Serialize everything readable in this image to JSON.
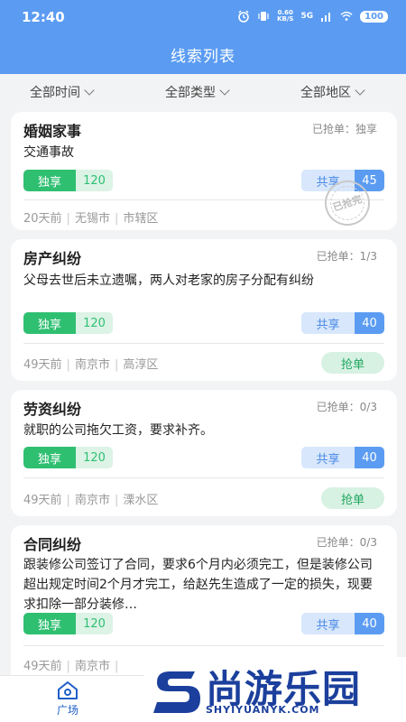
{
  "status": {
    "time": "12:40",
    "speed_value": "0.60",
    "speed_unit": "KB/S",
    "signal": "5G",
    "battery": "100"
  },
  "header": {
    "title": "线索列表"
  },
  "filters": [
    {
      "label": "全部时间"
    },
    {
      "label": "全部类型"
    },
    {
      "label": "全部地区"
    }
  ],
  "cards": [
    {
      "category": "婚姻家事",
      "grab_status": "已抢单：独享",
      "description": "交通事故",
      "exclusive_label": "独享",
      "exclusive_price": "120",
      "shared_label": "共享",
      "shared_price": "45",
      "days": "20天前",
      "city": "无锡市",
      "district": "市辖区",
      "stamp_text": "已抢完"
    },
    {
      "category": "房产纠纷",
      "grab_status": "已抢单：1/3",
      "description": "父母去世后未立遗嘱，两人对老家的房子分配有纠纷",
      "exclusive_label": "独享",
      "exclusive_price": "120",
      "shared_label": "共享",
      "shared_price": "40",
      "days": "49天前",
      "city": "南京市",
      "district": "高淳区",
      "action": "抢单"
    },
    {
      "category": "劳资纠纷",
      "grab_status": "已抢单：0/3",
      "description": "就职的公司拖欠工资，要求补齐。",
      "exclusive_label": "独享",
      "exclusive_price": "120",
      "shared_label": "共享",
      "shared_price": "40",
      "days": "49天前",
      "city": "南京市",
      "district": "溧水区",
      "action": "抢单"
    },
    {
      "category": "合同纠纷",
      "grab_status": "已抢单：0/3",
      "description": "跟装修公司签订了合同，要求6个月内必须完工，但是装修公司超出规定时间2个月才完工，给赵先生造成了一定的损失，现要求扣除一部分装修…",
      "exclusive_label": "独享",
      "exclusive_price": "120",
      "shared_label": "共享",
      "shared_price": "40",
      "days": "49天前",
      "city": "南京市"
    }
  ],
  "bottom_nav": {
    "home_label": "广场"
  },
  "watermark": {
    "brand": "尚游乐园",
    "url": "SHYIYUANYK.COM"
  },
  "colors": {
    "primary": "#5b9cf2",
    "green": "#2fbf71",
    "navy": "#1b3f9c"
  }
}
